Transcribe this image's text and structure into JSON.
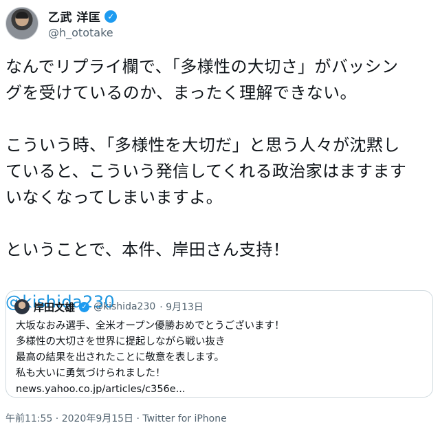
{
  "author": {
    "display_name": "乙武 洋匡",
    "handle": "@h_ototake",
    "verified_icon": "✓"
  },
  "tweet": {
    "paragraphs": [
      [
        "なんでリプライ欄で、「多様性の大切さ」がバッシン",
        "グを受けているのか、まったく理解できない。"
      ],
      [
        "こういう時、「多様性を大切だ」と思う人々が沈黙し",
        "ていると、こういう発信してくれる政治家はますます",
        "いなくなってしまいますよ。"
      ],
      [
        "ということで、本件、岸田さん支持！"
      ]
    ],
    "mention": "@kishida230"
  },
  "quoted_tweet": {
    "display_name": "岸田文雄",
    "handle": "@kishida230",
    "date": "· 9月13日",
    "lines": [
      "大坂なおみ選手、全米オープン優勝おめでとうございます！",
      "多様性の大切さを世界に提起しながら戦い抜き",
      "最高の結果を出されたことに敬意を表します。",
      "私も大いに勇気づけられました！",
      "news.yahoo.co.jp/articles/c356e..."
    ]
  },
  "footer": {
    "meta": "午前11:55 · 2020年9月15日 · Twitter for iPhone"
  },
  "colors": {
    "link": "#1b95e0",
    "verified": "#1d9bf0",
    "muted": "#536471"
  }
}
